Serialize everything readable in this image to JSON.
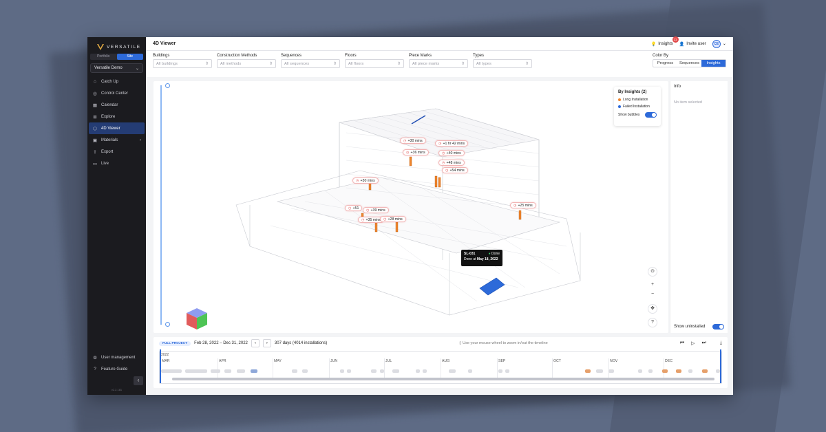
{
  "brand": {
    "name": "VERSATILE",
    "accent": "#2d6ad9"
  },
  "sidebar": {
    "modes": [
      "Portfolio",
      "Site"
    ],
    "project": "Versatile Demo",
    "items": [
      {
        "label": "Catch Up",
        "icon": "home-icon"
      },
      {
        "label": "Control Center",
        "icon": "target-icon"
      },
      {
        "label": "Calendar",
        "icon": "calendar-icon"
      },
      {
        "label": "Explore",
        "icon": "grid-icon"
      },
      {
        "label": "4D Viewer",
        "icon": "cube-icon"
      },
      {
        "label": "Materials",
        "icon": "box-icon"
      },
      {
        "label": "Export",
        "icon": "export-icon"
      },
      {
        "label": "Live",
        "icon": "video-icon"
      }
    ],
    "bottom_items": [
      {
        "label": "User management",
        "icon": "user-gear-icon"
      },
      {
        "label": "Feature Guide",
        "icon": "help-icon"
      }
    ],
    "version": "v2.2.181"
  },
  "header": {
    "title": "4D Viewer",
    "insights": "Insights",
    "insights_badge": "11",
    "invite": "Invite user",
    "avatar": "CE"
  },
  "filters": [
    {
      "label": "Buildings",
      "placeholder": "All buildings"
    },
    {
      "label": "Construction Methods",
      "placeholder": "All methods"
    },
    {
      "label": "Sequences",
      "placeholder": "All sequences"
    },
    {
      "label": "Floors",
      "placeholder": "All floors"
    },
    {
      "label": "Piece Marks",
      "placeholder": "All piece marks"
    },
    {
      "label": "Types",
      "placeholder": "All types"
    }
  ],
  "color_by": {
    "label": "Color By",
    "options": [
      "Progress",
      "Sequences",
      "Insights"
    ],
    "selected": "Insights"
  },
  "legend": {
    "title": "By Insights (2)",
    "items": [
      {
        "label": "Long Installation",
        "color": "#f0862e"
      },
      {
        "label": "Failed Installation",
        "color": "#2d6ad9"
      }
    ],
    "show_bubbles": "Show bubbles"
  },
  "bubbles": [
    "+30 mins",
    "+36 mins",
    "+1 hr 42 mins",
    "+40 mins",
    "+48 mins",
    "+54 mins",
    "+30 mins",
    "+25 mins",
    "+51",
    "+39 mins",
    "+35 mins",
    "+28 mins"
  ],
  "tooltip": {
    "id": "SL-031",
    "status": "Done",
    "done_prefix": "Done at",
    "date": "May 18, 2022"
  },
  "info": {
    "title": "Info",
    "empty": "No item selected",
    "show_uninstalled": "Show uninstalled"
  },
  "timeline": {
    "pill": "FULL PROJECT",
    "range": "Feb 28, 2022 – Dec 31, 2022",
    "summary": "307 days (4014 installations)",
    "hint": "Use your mouse wheel to zoom in/out the timeline",
    "year": "2022",
    "months": [
      "MAR",
      "APR",
      "MAY",
      "JUN",
      "JUL",
      "AUG",
      "SEP",
      "OCT",
      "NOV",
      "DEC"
    ]
  }
}
